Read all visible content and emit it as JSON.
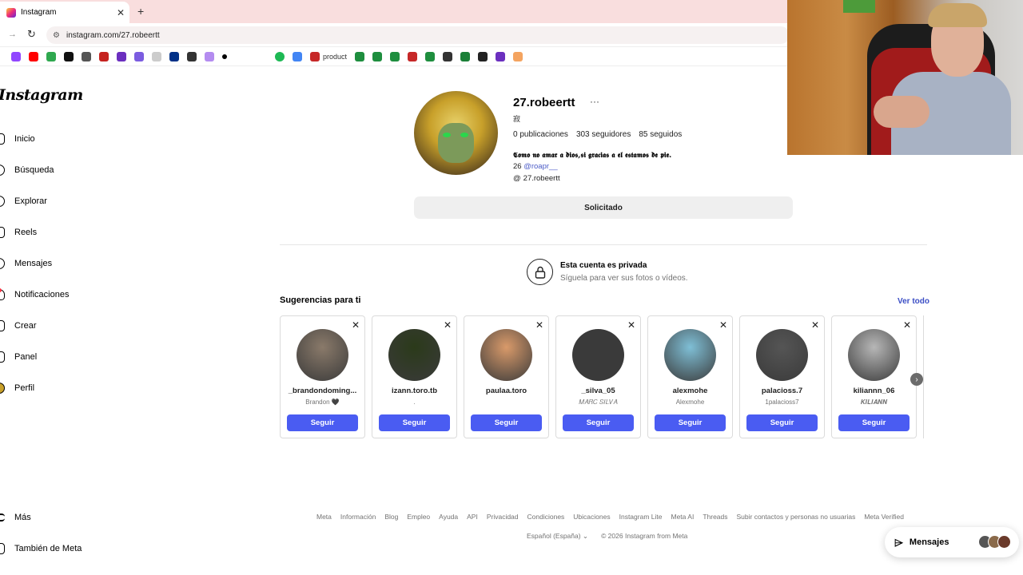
{
  "browser": {
    "tab_title": "Instagram",
    "tab_close": "✕",
    "new_tab": "+",
    "url": "instagram.com/27.robeertt",
    "bookmark_label": "product"
  },
  "sidebar": {
    "logo": "Instagram",
    "items": [
      {
        "label": "Inicio",
        "icon": "home-icon"
      },
      {
        "label": "Búsqueda",
        "icon": "search-icon"
      },
      {
        "label": "Explorar",
        "icon": "compass-icon"
      },
      {
        "label": "Reels",
        "icon": "reels-icon"
      },
      {
        "label": "Mensajes",
        "icon": "messenger-icon"
      },
      {
        "label": "Notificaciones",
        "icon": "heart-icon"
      },
      {
        "label": "Crear",
        "icon": "plus-icon"
      },
      {
        "label": "Panel",
        "icon": "dashboard-icon"
      },
      {
        "label": "Perfil",
        "icon": "profile-icon"
      }
    ],
    "more": "Más",
    "meta": "También de Meta"
  },
  "profile": {
    "username": "27.robeertt",
    "more": "···",
    "pronoun_glyph": "寂",
    "posts": "0 publicaciones",
    "followers": "303 seguidores",
    "following": "85 seguidos",
    "bio_line1": "𝕮𝖔𝖒𝖔 𝖓𝖔 𝖆𝖒𝖆𝖗 𝖆 𝖉𝖎𝖔𝖘,𝖘𝖎 𝖌𝖗𝖆𝖈𝖎𝖆𝖘 𝖆 𝖊𝖑 𝖊𝖘𝖙𝖆𝖒𝖔𝖘 𝖉𝖊 𝖕𝖎𝖊.",
    "bio_number": "26",
    "bio_mention": "@roapr__",
    "threads_handle": "27.robeertt",
    "threads_icon": "@",
    "request_button": "Solicitado"
  },
  "private": {
    "title": "Esta cuenta es privada",
    "subtitle": "Síguela para ver sus fotos o vídeos.",
    "lock_icon": "🔒"
  },
  "suggestions": {
    "title": "Sugerencias para ti",
    "see_all": "Ver todo",
    "dismiss": "✕",
    "next": "›",
    "cards": [
      {
        "username": "_brandondoming...",
        "subtitle": "Brandon 🖤",
        "button": "Seguir",
        "color": "#8a7a6a"
      },
      {
        "username": "izann.toro.tb",
        "subtitle": ".",
        "button": "Seguir",
        "color": "#2b3a1a"
      },
      {
        "username": "paulaa.toro",
        "subtitle": "",
        "button": "Seguir",
        "color": "#d99a6a"
      },
      {
        "username": "_silva_05",
        "subtitle": "𝑀𝐴𝑅𝐶 𝑆𝐼𝐿𝑉𝐴",
        "button": "Seguir",
        "color": "#3a3a3a"
      },
      {
        "username": "alexmohe",
        "subtitle": "Alexmohe",
        "button": "Seguir",
        "color": "#7fbfd6"
      },
      {
        "username": "palacioss.7",
        "subtitle": "1palacioss7",
        "button": "Seguir",
        "color": "#555555"
      },
      {
        "username": "kiliannn_06",
        "subtitle": "𝑲𝑰𝑳𝑰𝑨𝑵𝑵",
        "button": "Seguir",
        "color": "#b7b7b7"
      }
    ]
  },
  "footer": {
    "links": [
      "Meta",
      "Información",
      "Blog",
      "Empleo",
      "Ayuda",
      "API",
      "Privacidad",
      "Condiciones",
      "Ubicaciones",
      "Instagram Lite",
      "Meta AI",
      "Threads",
      "Subir contactos y personas no usuarias",
      "Meta Verified"
    ],
    "language": "Español (España) ⌄",
    "copyright": "© 2026 Instagram from Meta"
  },
  "messages_pill": {
    "label": "Mensajes",
    "icon": "⌲"
  },
  "colors": {
    "accent": "#4a5cf2",
    "link": "#3b4ec5",
    "tabbar": "#f9dede"
  }
}
